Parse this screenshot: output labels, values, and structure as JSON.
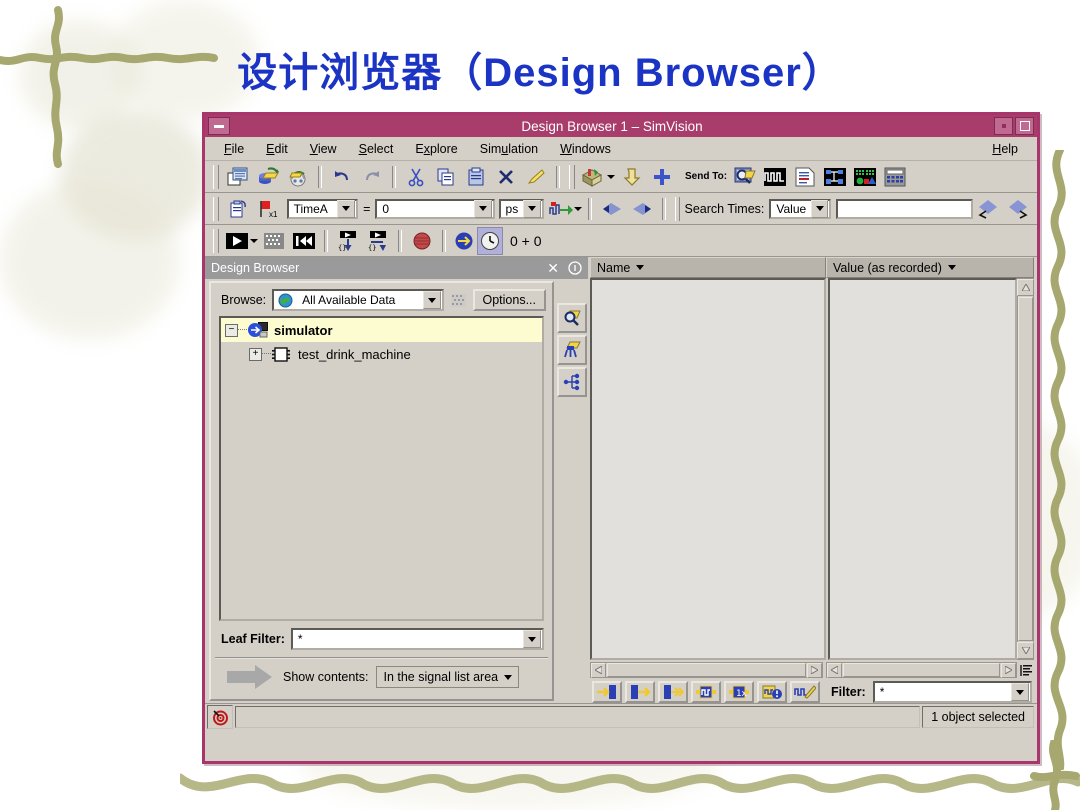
{
  "slide": {
    "title": "设计浏览器（Design Browser）",
    "title_color": "#1b34c4"
  },
  "window": {
    "title": "Design Browser 1 – SimVision",
    "titlebar_color": "#a83d6b",
    "minimize_label": "minimize",
    "restore_label": "restore",
    "maximize_label": "maximize"
  },
  "menubar": {
    "items": [
      {
        "label": "File",
        "accel": "F"
      },
      {
        "label": "Edit",
        "accel": "E"
      },
      {
        "label": "View",
        "accel": "V"
      },
      {
        "label": "Select",
        "accel": "S"
      },
      {
        "label": "Explore",
        "accel": "x"
      },
      {
        "label": "Simulation",
        "accel": "u"
      },
      {
        "label": "Windows",
        "accel": "W"
      }
    ],
    "help": "Help"
  },
  "toolbar1": {
    "icons": [
      "new-window-icon",
      "open-database-icon",
      "save-icon",
      "undo-icon",
      "redo-icon",
      "cut-icon",
      "copy-icon",
      "paste-icon",
      "delete-icon",
      "highlight-icon"
    ],
    "send_to_label": "Send To:",
    "send_to_icons": [
      "toolbox-icon",
      "down-arrow-icon",
      "plus-icon",
      "waveform-probe-icon",
      "waveform-window-icon",
      "source-browser-icon",
      "schematic-tracer-icon",
      "register-window-icon",
      "calculator-icon"
    ]
  },
  "toolbar2": {
    "icons": [
      "paste-marker-icon",
      "marker-x1-icon"
    ],
    "time_cursor": "TimeA",
    "equals": "=",
    "time_value": "0",
    "time_unit": "ps",
    "extra_icons": [
      "set-time-icon",
      "prev-marker-icon",
      "next-marker-icon"
    ],
    "search_label": "Search Times:",
    "search_mode": "Value",
    "search_value": "",
    "search_icons": [
      "search-prev-icon",
      "search-next-icon"
    ]
  },
  "toolbar3": {
    "icons": [
      "play-icon",
      "stop-icon",
      "restart-icon",
      "step-into-icon",
      "step-over-icon",
      "break-icon",
      "sim-time-icon",
      "clock-icon"
    ],
    "time_readout": "0 + 0"
  },
  "design_browser": {
    "panel_title": "Design Browser",
    "close_icon": "close-icon",
    "info_icon": "info-icon",
    "browse_label": "Browse:",
    "browse_value": "All Available Data",
    "browse_icon": "globe-icon",
    "scope_icon": "scope-icon",
    "options_label": "Options...",
    "side_buttons": [
      "find-icon",
      "select-all-icon",
      "hierarchy-icon"
    ],
    "tree": [
      {
        "label": "simulator",
        "icon": "simulator-icon",
        "expander": "−",
        "depth": 0,
        "selected": true,
        "bold": true
      },
      {
        "label": "test_drink_machine",
        "icon": "module-icon",
        "expander": "+",
        "depth": 1,
        "selected": false,
        "bold": false
      }
    ],
    "leaf_filter_label": "Leaf Filter:",
    "leaf_filter_value": "*",
    "show_contents_label": "Show contents:",
    "show_contents_value": "In the signal list area",
    "show_contents_icon": "right-arrow-icon"
  },
  "signal_list": {
    "columns": [
      {
        "label": "Name",
        "sort_icon": "sort-down-icon"
      },
      {
        "label": "Value (as recorded)",
        "sort_icon": "sort-down-icon"
      }
    ],
    "rows": [],
    "action_icons": [
      "send-to-waveform-icon",
      "send-to-right-icon",
      "send-to-end-icon",
      "signal-props-icon",
      "rename-icon",
      "alert-signal-icon",
      "edit-waveform-icon"
    ],
    "filter_label": "Filter:",
    "filter_value": "*",
    "list-options-icon": "list-options-icon"
  },
  "statusbar": {
    "icon": "target-icon",
    "message": "",
    "selection": "1 object selected"
  }
}
